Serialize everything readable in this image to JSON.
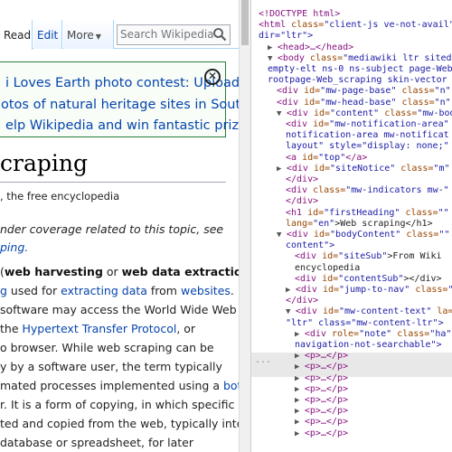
{
  "wiki": {
    "tabs": {
      "read": "Read",
      "edit": "Edit",
      "more": "More"
    },
    "search_placeholder": "Search Wikipedia",
    "banner": {
      "line1": "i Loves Earth photo contest: Upload",
      "line2": "otos of natural heritage sites in South",
      "line3": "elp Wikipedia and win fantastic prizes!",
      "close": "✕"
    },
    "title": "craping",
    "site_sub": ", the free encyclopedia",
    "hatnote1": "nder coverage related to this topic, see",
    "hatnote2": "ping.",
    "paragraph": [
      {
        "before": "(",
        "b1": "web harvesting",
        "mid": " or ",
        "b2": "web data extraction",
        "after": ")"
      },
      {
        "link1": "g",
        "mid": " used for ",
        "link2": "extracting data",
        "mid2": " from ",
        "link3": "websites",
        "after": "."
      },
      {
        "text": "software may access the World Wide Web"
      },
      {
        "before": "the ",
        "link": "Hypertext Transfer Protocol",
        "after": ", or"
      },
      {
        "text": "o browser. While web scraping can be"
      },
      {
        "text": "y by a software user, the term typically"
      },
      {
        "before": "mated processes implemented using a ",
        "link": "bot"
      },
      {
        "text": "r. It is a form of copying, in which specific"
      },
      {
        "text": "ted and copied from the web, typically into"
      },
      {
        "text": "database or spreadsheet, for later"
      }
    ]
  },
  "devtools": {
    "lines": [
      {
        "indent": 0,
        "tri": "",
        "html": "<!DOCTYPE html>"
      },
      {
        "indent": 0,
        "tri": "",
        "tag": "<html ",
        "attrs": [
          [
            "class",
            "client-js ve-not-avail"
          ]
        ]
      },
      {
        "indent": 0,
        "tri": "",
        "cont": "dir=\"ltr\">"
      },
      {
        "indent": 1,
        "tri": "▶",
        "tag": "<head>",
        "text": "…</head>"
      },
      {
        "indent": 1,
        "tri": "▼",
        "tag": "<body ",
        "attrs": [
          [
            "class",
            "mediawiki ltr sitedir"
          ]
        ]
      },
      {
        "indent": 1,
        "tri": "",
        "cont": "empty-elt ns-0 ns-subject page-Web_s"
      },
      {
        "indent": 1,
        "tri": "",
        "cont": "rootpage-Web_scraping skin-vector ac"
      },
      {
        "indent": 2,
        "tri": "",
        "tag": "<div ",
        "attrs": [
          [
            "id",
            "mw-page-base"
          ],
          [
            "class",
            "n"
          ]
        ]
      },
      {
        "indent": 2,
        "tri": "",
        "tag": "<div ",
        "attrs": [
          [
            "id",
            "mw-head-base"
          ],
          [
            "class",
            "n"
          ]
        ]
      },
      {
        "indent": 2,
        "tri": "▼",
        "tag": "<div ",
        "attrs": [
          [
            "id",
            "content"
          ],
          [
            "class",
            "mw-bod"
          ]
        ]
      },
      {
        "indent": 3,
        "tri": "",
        "tag": "<div ",
        "attrs": [
          [
            "id",
            "mw-notification-area"
          ]
        ]
      },
      {
        "indent": 3,
        "tri": "",
        "cont": "notification-area mw-notificat"
      },
      {
        "indent": 3,
        "tri": "",
        "cont": "layout\" style=\"display: none;\""
      },
      {
        "indent": 3,
        "tri": "",
        "tag": "<a ",
        "attrs": [
          [
            "id",
            "top"
          ]
        ],
        "text": "</a>"
      },
      {
        "indent": 2,
        "tri": "▶",
        "tag": "<div ",
        "attrs": [
          [
            "id",
            "siteNotice"
          ],
          [
            "class",
            "m"
          ]
        ]
      },
      {
        "indent": 3,
        "tri": "",
        "tag": "</div>"
      },
      {
        "indent": 3,
        "tri": "",
        "tag": "<div ",
        "attrs": [
          [
            "class",
            "mw-indicators mw-"
          ]
        ]
      },
      {
        "indent": 3,
        "tri": "",
        "tag": "</div>"
      },
      {
        "indent": 3,
        "tri": "",
        "tag": "<h1 ",
        "attrs": [
          [
            "id",
            "firstHeading"
          ],
          [
            "class",
            ""
          ]
        ]
      },
      {
        "indent": 3,
        "tri": "",
        "cont2": [
          "lang",
          "en"
        ],
        "text": ">Web scraping</h1>"
      },
      {
        "indent": 2,
        "tri": "▼",
        "tag": "<div ",
        "attrs": [
          [
            "id",
            "bodyContent"
          ],
          [
            "class",
            ""
          ]
        ]
      },
      {
        "indent": 3,
        "tri": "",
        "cont": "content\">"
      },
      {
        "indent": 4,
        "tri": "",
        "tag": "<div ",
        "attrs": [
          [
            "id",
            "siteSub"
          ]
        ],
        "text": ">From Wiki"
      },
      {
        "indent": 4,
        "tri": "",
        "text": "encyclopedia"
      },
      {
        "indent": 4,
        "tri": "",
        "tag": "<div ",
        "attrs": [
          [
            "id",
            "contentSub"
          ]
        ],
        "text": "></div>"
      },
      {
        "indent": 3,
        "tri": "▶",
        "tag": "<div ",
        "attrs": [
          [
            "id",
            "jump-to-nav"
          ],
          [
            "class",
            ""
          ]
        ]
      },
      {
        "indent": 3,
        "tri": "",
        "tag": "</div>"
      },
      {
        "indent": 3,
        "tri": "▼",
        "tag": "<div ",
        "attrs": [
          [
            "id",
            "mw-content-text"
          ],
          [
            "la",
            ""
          ]
        ]
      },
      {
        "indent": 3,
        "tri": "",
        "cont": "\"ltr\" class=\"mw-content-ltr\">"
      },
      {
        "indent": 4,
        "tri": "▶",
        "tag": "<div ",
        "attrs": [
          [
            "role",
            "note"
          ],
          [
            "class",
            "ha"
          ]
        ],
        "sel": true
      },
      {
        "indent": 4,
        "tri": "",
        "cont": "navigation-not-searchable\">",
        "sel": true
      },
      {
        "indent": 4,
        "tri": "▶",
        "tag": "<p>",
        "text": "…</p>"
      },
      {
        "indent": 4,
        "tri": "▶",
        "tag": "<p>",
        "text": "…</p>"
      },
      {
        "indent": 4,
        "tri": "▶",
        "tag": "<p>",
        "text": "…</p>"
      },
      {
        "indent": 4,
        "tri": "▶",
        "tag": "<p>",
        "text": "…</p>"
      },
      {
        "indent": 4,
        "tri": "▶",
        "tag": "<p>",
        "text": "…</p>"
      },
      {
        "indent": 4,
        "tri": "▶",
        "tag": "<p>",
        "text": "…</p>"
      },
      {
        "indent": 4,
        "tri": "▶",
        "tag": "<p>",
        "text": "…</p>"
      },
      {
        "indent": 4,
        "tri": "▶",
        "tag": "<p>",
        "text": "…</p>"
      }
    ],
    "selected_marker": "..."
  }
}
